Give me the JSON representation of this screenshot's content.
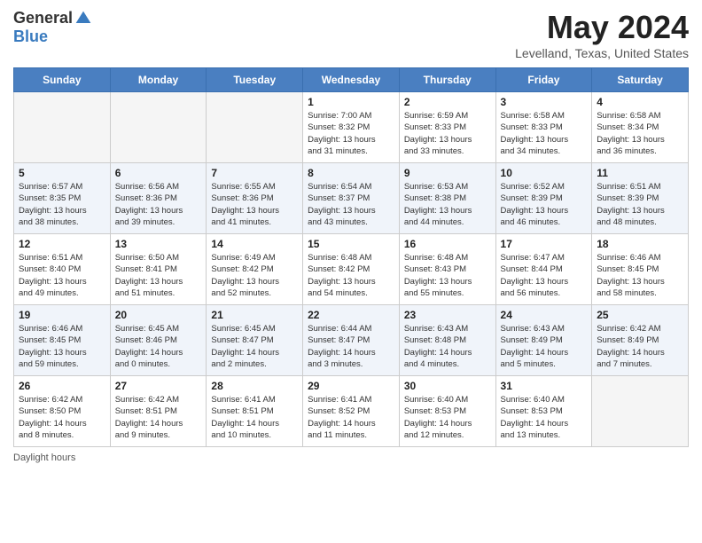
{
  "header": {
    "logo_general": "General",
    "logo_blue": "Blue",
    "month_title": "May 2024",
    "location": "Levelland, Texas, United States"
  },
  "days_of_week": [
    "Sunday",
    "Monday",
    "Tuesday",
    "Wednesday",
    "Thursday",
    "Friday",
    "Saturday"
  ],
  "weeks": [
    [
      {
        "day": "",
        "info": ""
      },
      {
        "day": "",
        "info": ""
      },
      {
        "day": "",
        "info": ""
      },
      {
        "day": "1",
        "info": "Sunrise: 7:00 AM\nSunset: 8:32 PM\nDaylight: 13 hours\nand 31 minutes."
      },
      {
        "day": "2",
        "info": "Sunrise: 6:59 AM\nSunset: 8:33 PM\nDaylight: 13 hours\nand 33 minutes."
      },
      {
        "day": "3",
        "info": "Sunrise: 6:58 AM\nSunset: 8:33 PM\nDaylight: 13 hours\nand 34 minutes."
      },
      {
        "day": "4",
        "info": "Sunrise: 6:58 AM\nSunset: 8:34 PM\nDaylight: 13 hours\nand 36 minutes."
      }
    ],
    [
      {
        "day": "5",
        "info": "Sunrise: 6:57 AM\nSunset: 8:35 PM\nDaylight: 13 hours\nand 38 minutes."
      },
      {
        "day": "6",
        "info": "Sunrise: 6:56 AM\nSunset: 8:36 PM\nDaylight: 13 hours\nand 39 minutes."
      },
      {
        "day": "7",
        "info": "Sunrise: 6:55 AM\nSunset: 8:36 PM\nDaylight: 13 hours\nand 41 minutes."
      },
      {
        "day": "8",
        "info": "Sunrise: 6:54 AM\nSunset: 8:37 PM\nDaylight: 13 hours\nand 43 minutes."
      },
      {
        "day": "9",
        "info": "Sunrise: 6:53 AM\nSunset: 8:38 PM\nDaylight: 13 hours\nand 44 minutes."
      },
      {
        "day": "10",
        "info": "Sunrise: 6:52 AM\nSunset: 8:39 PM\nDaylight: 13 hours\nand 46 minutes."
      },
      {
        "day": "11",
        "info": "Sunrise: 6:51 AM\nSunset: 8:39 PM\nDaylight: 13 hours\nand 48 minutes."
      }
    ],
    [
      {
        "day": "12",
        "info": "Sunrise: 6:51 AM\nSunset: 8:40 PM\nDaylight: 13 hours\nand 49 minutes."
      },
      {
        "day": "13",
        "info": "Sunrise: 6:50 AM\nSunset: 8:41 PM\nDaylight: 13 hours\nand 51 minutes."
      },
      {
        "day": "14",
        "info": "Sunrise: 6:49 AM\nSunset: 8:42 PM\nDaylight: 13 hours\nand 52 minutes."
      },
      {
        "day": "15",
        "info": "Sunrise: 6:48 AM\nSunset: 8:42 PM\nDaylight: 13 hours\nand 54 minutes."
      },
      {
        "day": "16",
        "info": "Sunrise: 6:48 AM\nSunset: 8:43 PM\nDaylight: 13 hours\nand 55 minutes."
      },
      {
        "day": "17",
        "info": "Sunrise: 6:47 AM\nSunset: 8:44 PM\nDaylight: 13 hours\nand 56 minutes."
      },
      {
        "day": "18",
        "info": "Sunrise: 6:46 AM\nSunset: 8:45 PM\nDaylight: 13 hours\nand 58 minutes."
      }
    ],
    [
      {
        "day": "19",
        "info": "Sunrise: 6:46 AM\nSunset: 8:45 PM\nDaylight: 13 hours\nand 59 minutes."
      },
      {
        "day": "20",
        "info": "Sunrise: 6:45 AM\nSunset: 8:46 PM\nDaylight: 14 hours\nand 0 minutes."
      },
      {
        "day": "21",
        "info": "Sunrise: 6:45 AM\nSunset: 8:47 PM\nDaylight: 14 hours\nand 2 minutes."
      },
      {
        "day": "22",
        "info": "Sunrise: 6:44 AM\nSunset: 8:47 PM\nDaylight: 14 hours\nand 3 minutes."
      },
      {
        "day": "23",
        "info": "Sunrise: 6:43 AM\nSunset: 8:48 PM\nDaylight: 14 hours\nand 4 minutes."
      },
      {
        "day": "24",
        "info": "Sunrise: 6:43 AM\nSunset: 8:49 PM\nDaylight: 14 hours\nand 5 minutes."
      },
      {
        "day": "25",
        "info": "Sunrise: 6:42 AM\nSunset: 8:49 PM\nDaylight: 14 hours\nand 7 minutes."
      }
    ],
    [
      {
        "day": "26",
        "info": "Sunrise: 6:42 AM\nSunset: 8:50 PM\nDaylight: 14 hours\nand 8 minutes."
      },
      {
        "day": "27",
        "info": "Sunrise: 6:42 AM\nSunset: 8:51 PM\nDaylight: 14 hours\nand 9 minutes."
      },
      {
        "day": "28",
        "info": "Sunrise: 6:41 AM\nSunset: 8:51 PM\nDaylight: 14 hours\nand 10 minutes."
      },
      {
        "day": "29",
        "info": "Sunrise: 6:41 AM\nSunset: 8:52 PM\nDaylight: 14 hours\nand 11 minutes."
      },
      {
        "day": "30",
        "info": "Sunrise: 6:40 AM\nSunset: 8:53 PM\nDaylight: 14 hours\nand 12 minutes."
      },
      {
        "day": "31",
        "info": "Sunrise: 6:40 AM\nSunset: 8:53 PM\nDaylight: 14 hours\nand 13 minutes."
      },
      {
        "day": "",
        "info": ""
      }
    ]
  ],
  "footer": {
    "note": "Daylight hours"
  }
}
